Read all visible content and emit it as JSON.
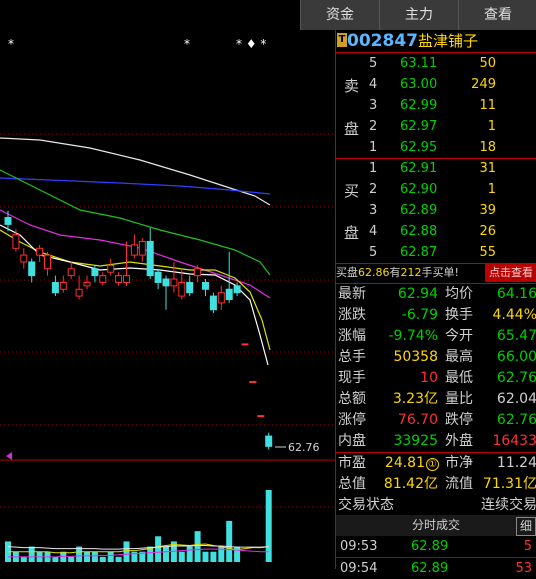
{
  "header": {
    "tabs": [
      "资金",
      "主力",
      "查看"
    ]
  },
  "chart_markers": {
    "stars_left": "*",
    "stars_mid": "*",
    "stars_right": "* ♦ *"
  },
  "chart_data": {
    "type": "candlestick",
    "last_price_label": "62.76",
    "candles": [
      {
        "o": 63.95,
        "c": 63.85,
        "h": 64.05,
        "l": 63.75
      },
      {
        "o": 63.5,
        "c": 63.7,
        "h": 63.78,
        "l": 63.45
      },
      {
        "o": 63.3,
        "c": 63.4,
        "h": 63.5,
        "l": 63.2
      },
      {
        "o": 63.3,
        "c": 63.1,
        "h": 63.35,
        "l": 63.0
      },
      {
        "o": 63.4,
        "c": 63.5,
        "h": 63.55,
        "l": 63.3
      },
      {
        "o": 63.2,
        "c": 63.4,
        "h": 63.45,
        "l": 63.1
      },
      {
        "o": 63.0,
        "c": 62.85,
        "h": 63.1,
        "l": 62.8
      },
      {
        "o": 62.9,
        "c": 63.0,
        "h": 63.1,
        "l": 62.85
      },
      {
        "o": 63.1,
        "c": 63.2,
        "h": 63.3,
        "l": 63.05
      },
      {
        "o": 62.8,
        "c": 62.9,
        "h": 63.1,
        "l": 62.75
      },
      {
        "o": 62.95,
        "c": 63.0,
        "h": 63.1,
        "l": 62.9
      },
      {
        "o": 63.2,
        "c": 63.1,
        "h": 63.25,
        "l": 63.0
      },
      {
        "o": 63.0,
        "c": 63.1,
        "h": 63.15,
        "l": 62.95
      },
      {
        "o": 63.15,
        "c": 63.25,
        "h": 63.35,
        "l": 63.1
      },
      {
        "o": 63.0,
        "c": 63.1,
        "h": 63.15,
        "l": 62.95
      },
      {
        "o": 63.0,
        "c": 63.1,
        "h": 63.6,
        "l": 62.95
      },
      {
        "o": 63.4,
        "c": 63.55,
        "h": 63.7,
        "l": 63.35
      },
      {
        "o": 63.4,
        "c": 63.6,
        "h": 63.65,
        "l": 63.3
      },
      {
        "o": 63.6,
        "c": 63.1,
        "h": 63.8,
        "l": 63.05
      },
      {
        "o": 63.15,
        "c": 63.0,
        "h": 63.2,
        "l": 62.9
      },
      {
        "o": 63.05,
        "c": 62.95,
        "h": 63.1,
        "l": 62.6
      },
      {
        "o": 62.95,
        "c": 63.05,
        "h": 63.3,
        "l": 62.85
      },
      {
        "o": 62.8,
        "c": 63.0,
        "h": 63.2,
        "l": 62.75
      },
      {
        "o": 63.0,
        "c": 62.85,
        "h": 63.1,
        "l": 62.8
      },
      {
        "o": 63.1,
        "c": 63.2,
        "h": 63.25,
        "l": 63.0
      },
      {
        "o": 63.0,
        "c": 62.9,
        "h": 63.05,
        "l": 62.8
      },
      {
        "o": 62.8,
        "c": 62.6,
        "h": 62.85,
        "l": 62.55
      },
      {
        "o": 62.7,
        "c": 62.85,
        "h": 62.95,
        "l": 62.6
      },
      {
        "o": 62.9,
        "c": 62.75,
        "h": 63.45,
        "l": 62.7
      },
      {
        "o": 62.95,
        "c": 62.85,
        "h": 63.0,
        "l": 62.8
      },
      {
        "o": 62.1,
        "c": 62.1,
        "h": 62.1,
        "l": 62.1
      },
      {
        "o": 61.55,
        "c": 61.55,
        "h": 61.55,
        "l": 61.55
      },
      {
        "o": 61.05,
        "c": 61.05,
        "h": 61.05,
        "l": 61.05
      },
      {
        "o": 60.75,
        "c": 60.6,
        "h": 60.8,
        "l": 60.55
      }
    ],
    "volumes": [
      4,
      2,
      1,
      3,
      2,
      2,
      1,
      2,
      1,
      3,
      2,
      2,
      1,
      2,
      1,
      4,
      2,
      2,
      3,
      5,
      3,
      4,
      2,
      3,
      6,
      2,
      2,
      3,
      8,
      3,
      0,
      0,
      0,
      14
    ],
    "ma_yellow_volume": [
      2,
      2,
      2,
      2,
      2,
      2,
      1.8,
      1.8,
      1.8,
      2,
      2,
      2,
      2,
      2,
      2,
      2.2,
      2.2,
      2.4,
      2.6,
      3,
      3.2,
      3.4,
      3.3,
      3.2,
      3.4,
      3.5,
      3.2,
      3,
      2.6,
      2.4,
      2.6,
      2.8,
      2.8,
      3
    ],
    "ma_white_volume": [
      3,
      2.9,
      2.8,
      2.8,
      2.8,
      2.7,
      2.6,
      2.6,
      2.6,
      2.6,
      2.6,
      2.6,
      2.5,
      2.5,
      2.5,
      2.6,
      2.6,
      2.7,
      2.8,
      2.9,
      3,
      3.1,
      3.1,
      3.1,
      3.2,
      3.2,
      3.1,
      3.1,
      3,
      2.9,
      2.9,
      2.9,
      2.9,
      3
    ],
    "ma_purple_volume": [
      1,
      1,
      1,
      1,
      1,
      1,
      1,
      1.1,
      1.1,
      1.2,
      1.2,
      1.2,
      1.3,
      1.3,
      1.4,
      1.5,
      1.6,
      1.7,
      1.8,
      1.9,
      2,
      2.1,
      2.2,
      2.3,
      2.4,
      2.5,
      2.5,
      2.5,
      2.4,
      2.3,
      2.2,
      2.1,
      2,
      2
    ]
  },
  "stock": {
    "flag": "T",
    "code": "002847",
    "name": "盐津铺子"
  },
  "orderbook": {
    "sell_label_1": "卖",
    "sell_label_2": "盘",
    "buy_label_1": "买",
    "buy_label_2": "盘",
    "sell": [
      {
        "level": "5",
        "price": "63.11",
        "vol": "50"
      },
      {
        "level": "4",
        "price": "63.00",
        "vol": "249"
      },
      {
        "level": "3",
        "price": "62.99",
        "vol": "11"
      },
      {
        "level": "2",
        "price": "62.97",
        "vol": "1"
      },
      {
        "level": "1",
        "price": "62.95",
        "vol": "18"
      }
    ],
    "buy": [
      {
        "level": "1",
        "price": "62.91",
        "vol": "31"
      },
      {
        "level": "2",
        "price": "62.90",
        "vol": "1"
      },
      {
        "level": "3",
        "price": "62.89",
        "vol": "39"
      },
      {
        "level": "4",
        "price": "62.88",
        "vol": "26"
      },
      {
        "level": "5",
        "price": "62.87",
        "vol": "55"
      }
    ]
  },
  "notice": {
    "prefix": "买盘",
    "price": "62.86",
    "mid": "有",
    "qty": "212",
    "suffix": "手买单!",
    "button": "点击查看"
  },
  "quotes": [
    {
      "l1": "最新",
      "v1": "62.94",
      "c1": "g",
      "l2": "均价",
      "v2": "64.16",
      "c2": "g"
    },
    {
      "l1": "涨跌",
      "v1": "-6.79",
      "c1": "g",
      "l2": "换手",
      "v2": "4.44%",
      "c2": "y"
    },
    {
      "l1": "涨幅",
      "v1": "-9.74%",
      "c1": "g",
      "l2": "今开",
      "v2": "65.47",
      "c2": "g"
    },
    {
      "l1": "总手",
      "v1": "50358",
      "c1": "y",
      "l2": "最高",
      "v2": "66.00",
      "c2": "g"
    },
    {
      "l1": "现手",
      "v1": "10",
      "c1": "r",
      "l2": "最低",
      "v2": "62.76",
      "c2": "g"
    },
    {
      "l1": "总额",
      "v1": "3.23亿",
      "c1": "y",
      "l2": "量比",
      "v2": "62.04",
      "c2": "w"
    },
    {
      "l1": "涨停",
      "v1": "76.70",
      "c1": "r",
      "l2": "跌停",
      "v2": "62.76",
      "c2": "g"
    },
    {
      "l1": "内盘",
      "v1": "33925",
      "c1": "g",
      "l2": "外盘",
      "v2": "16433",
      "c2": "r"
    }
  ],
  "valuation": {
    "pe_label": "市盈",
    "pe_value": "24.81",
    "pe_badge": "①",
    "pb_label": "市净",
    "pb_value": "11.24",
    "mv_label": "总值",
    "mv_value": "81.42亿",
    "float_label": "流值",
    "float_value": "71.31亿",
    "status_label": "交易状态",
    "status_value": "连续交易"
  },
  "trades": {
    "header": "分时成交",
    "detail_button": "细",
    "rows": [
      {
        "time": "09:53",
        "price": "62.89",
        "vol": "5"
      },
      {
        "time": "09:54",
        "price": "62.89",
        "vol": "53"
      }
    ]
  },
  "colors": {
    "up": "#ff3030",
    "down": "#00d000",
    "accent": "#ffd700",
    "border": "#c00000",
    "code": "#5ab6ff"
  }
}
